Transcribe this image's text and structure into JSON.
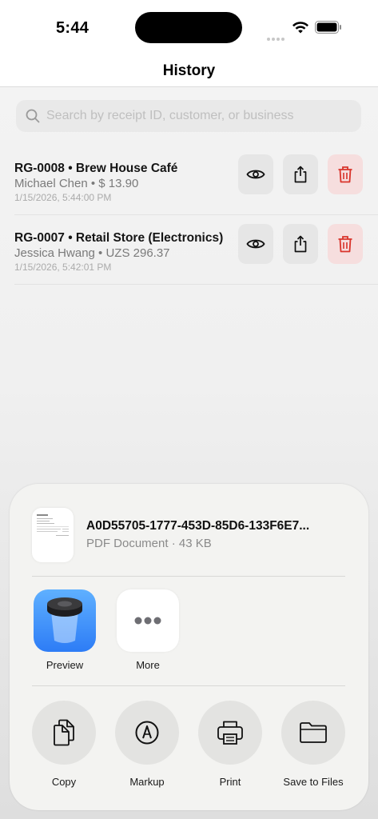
{
  "status_bar": {
    "time": "5:44"
  },
  "nav": {
    "title": "History"
  },
  "search": {
    "placeholder": "Search by receipt ID, customer, or business"
  },
  "receipts": [
    {
      "title": "RG-0008 • Brew House Café",
      "subtitle": "Michael Chen • $ 13.90",
      "date": "1/15/2026, 5:44:00 PM"
    },
    {
      "title": "RG-0007 • Retail Store (Electronics)",
      "subtitle": "Jessica Hwang • UZS 296.37",
      "date": "1/15/2026, 5:42:01 PM"
    }
  ],
  "share_sheet": {
    "file_name": "A0D55705-1777-453D-85D6-133F6E7...",
    "file_meta": "PDF Document · 43 KB",
    "apps": [
      {
        "label": "Preview",
        "icon": "preview-app-icon"
      },
      {
        "label": "More",
        "icon": "more-icon"
      }
    ],
    "actions": [
      {
        "label": "Copy",
        "icon": "copy-icon"
      },
      {
        "label": "Markup",
        "icon": "markup-icon"
      },
      {
        "label": "Print",
        "icon": "print-icon"
      },
      {
        "label": "Save to Files",
        "icon": "folder-icon"
      }
    ]
  },
  "colors": {
    "delete_bg": "#f6dede",
    "delete_icon": "#d9342b",
    "preview_blue": "#2d7cf6"
  }
}
